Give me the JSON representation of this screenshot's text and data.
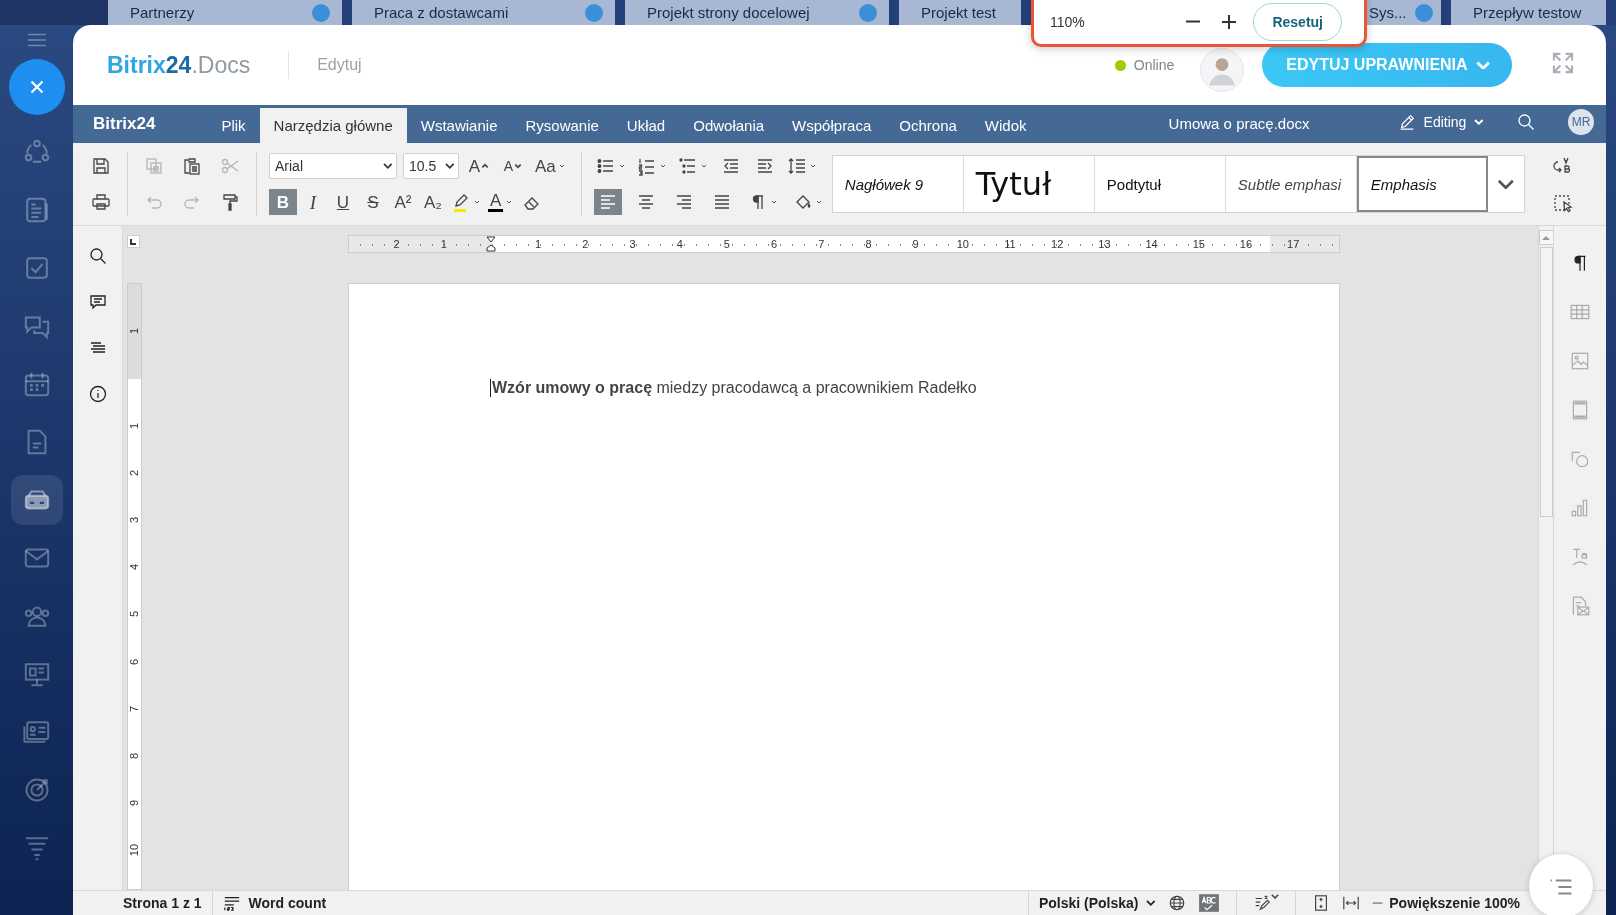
{
  "background_tabs": [
    {
      "label": "Partnerzy"
    },
    {
      "label": "Praca z dostawcami"
    },
    {
      "label": "Projekt strony docelowej"
    },
    {
      "label": "Projekt test"
    },
    {
      "label": "Sys..."
    },
    {
      "label": "Przepływ testow"
    }
  ],
  "sidebar": {
    "items": [
      {
        "kind": "feed",
        "selected": false
      },
      {
        "kind": "news",
        "selected": false
      },
      {
        "kind": "tasks",
        "selected": false
      },
      {
        "kind": "chat",
        "selected": false
      },
      {
        "kind": "calendar",
        "selected": false
      },
      {
        "kind": "document",
        "selected": false
      },
      {
        "kind": "drive",
        "selected": true
      },
      {
        "kind": "mail",
        "selected": false
      },
      {
        "kind": "people",
        "selected": false
      },
      {
        "kind": "board",
        "selected": false
      },
      {
        "kind": "card",
        "selected": false
      },
      {
        "kind": "target",
        "selected": false
      },
      {
        "kind": "funnel",
        "selected": false
      }
    ]
  },
  "zoom_popup": {
    "value": "110%",
    "reset": "Resetuj"
  },
  "header": {
    "brand": "Bitrix",
    "brand_number": "24",
    "product": ".Docs",
    "mode": "Edytuj",
    "status": "Online",
    "online": true,
    "permissions_button": "EDYTUJ UPRAWNIENIA"
  },
  "menu": {
    "brand": "Bitrix24",
    "tabs": [
      {
        "label": "Plik",
        "selected": false
      },
      {
        "label": "Narzędzia główne",
        "selected": true
      },
      {
        "label": "Wstawianie",
        "selected": false
      },
      {
        "label": "Rysowanie",
        "selected": false
      },
      {
        "label": "Układ",
        "selected": false
      },
      {
        "label": "Odwołania",
        "selected": false
      },
      {
        "label": "Współpraca",
        "selected": false
      },
      {
        "label": "Ochrona",
        "selected": false
      },
      {
        "label": "Widok",
        "selected": false
      }
    ],
    "document_title": "Umowa o pracę.docx",
    "mode": "Editing",
    "user_initials": "MR"
  },
  "toolbar": {
    "file": [
      {
        "kind": "save",
        "disabled": false
      },
      {
        "kind": "print",
        "disabled": false
      }
    ],
    "clipboard": [
      {
        "kind": "copy",
        "disabled": true
      },
      {
        "kind": "paste",
        "disabled": false
      },
      {
        "kind": "cut",
        "disabled": true
      },
      {
        "kind": "undo",
        "disabled": true
      },
      {
        "kind": "redo",
        "disabled": true
      },
      {
        "kind": "painter",
        "disabled": false
      }
    ],
    "font": "Arial",
    "font_size": "10.5",
    "font_buttons": [
      {
        "kind": "grow",
        "glyph": "A"
      },
      {
        "kind": "shrink",
        "glyph": "A"
      },
      {
        "kind": "case",
        "glyph": "Aa"
      }
    ],
    "format": [
      {
        "kind": "bold",
        "glyph": "B",
        "active": true
      },
      {
        "kind": "italic",
        "glyph": "I",
        "active": false
      },
      {
        "kind": "underline",
        "glyph": "U",
        "active": false
      },
      {
        "kind": "strike",
        "glyph": "S",
        "active": false
      },
      {
        "kind": "superscript",
        "glyph": "A²",
        "active": false
      },
      {
        "kind": "subscript",
        "glyph": "A₂",
        "active": false
      },
      {
        "kind": "highlight",
        "active": false
      },
      {
        "kind": "font-color",
        "glyph": "A",
        "active": false
      },
      {
        "kind": "clear",
        "active": false
      }
    ],
    "paragraph_top": [
      {
        "kind": "bullets"
      },
      {
        "kind": "numbering"
      },
      {
        "kind": "multilevel"
      },
      {
        "kind": "outdent"
      },
      {
        "kind": "indent"
      },
      {
        "kind": "spacing"
      }
    ],
    "paragraph_bottom": [
      {
        "kind": "align-left",
        "active": true
      },
      {
        "kind": "align-center",
        "active": false
      },
      {
        "kind": "align-right",
        "active": false
      },
      {
        "kind": "justify",
        "active": false
      },
      {
        "kind": "marks",
        "active": false
      },
      {
        "kind": "shading",
        "active": false
      }
    ],
    "styles": [
      {
        "label": "Nagłówek 9",
        "kind": "heading",
        "selected": false
      },
      {
        "label": "Tytuł",
        "kind": "title",
        "selected": false
      },
      {
        "label": "Podtytuł",
        "kind": "subtitle",
        "selected": false
      },
      {
        "label": "Subtle emphasi",
        "kind": "subtle",
        "selected": false
      },
      {
        "label": "Emphasis",
        "kind": "emphasis",
        "selected": true
      }
    ]
  },
  "ruler": {
    "left_labels": [
      "2",
      "1"
    ],
    "labels": [
      "1",
      "2",
      "3",
      "4",
      "5",
      "6",
      "7",
      "8",
      "9",
      "10",
      "11",
      "12",
      "13",
      "14",
      "15",
      "16",
      "17"
    ],
    "top_labels": [
      "1"
    ],
    "vertical_labels": [
      "1",
      "2",
      "3",
      "4",
      "5",
      "6",
      "7",
      "8",
      "9",
      "10"
    ]
  },
  "document": {
    "paragraph": "**Wzór umowy o pracę** miedzy pracodawcą a pracownikiem Radełko"
  },
  "right_panel": {
    "items": [
      {
        "kind": "marks",
        "disabled": false
      },
      {
        "kind": "table",
        "disabled": true
      },
      {
        "kind": "image",
        "disabled": true
      },
      {
        "kind": "header-footer",
        "disabled": true
      },
      {
        "kind": "shapes",
        "disabled": true
      },
      {
        "kind": "chart",
        "disabled": true
      },
      {
        "kind": "textart",
        "disabled": true
      },
      {
        "kind": "mailmerge",
        "disabled": true
      }
    ]
  },
  "status_bar": {
    "page": "Strona 1 z 1",
    "word_count": "Word count",
    "language": "Polski (Polska)",
    "spellcheck": true,
    "zoom": "Powiększenie 100%"
  }
}
